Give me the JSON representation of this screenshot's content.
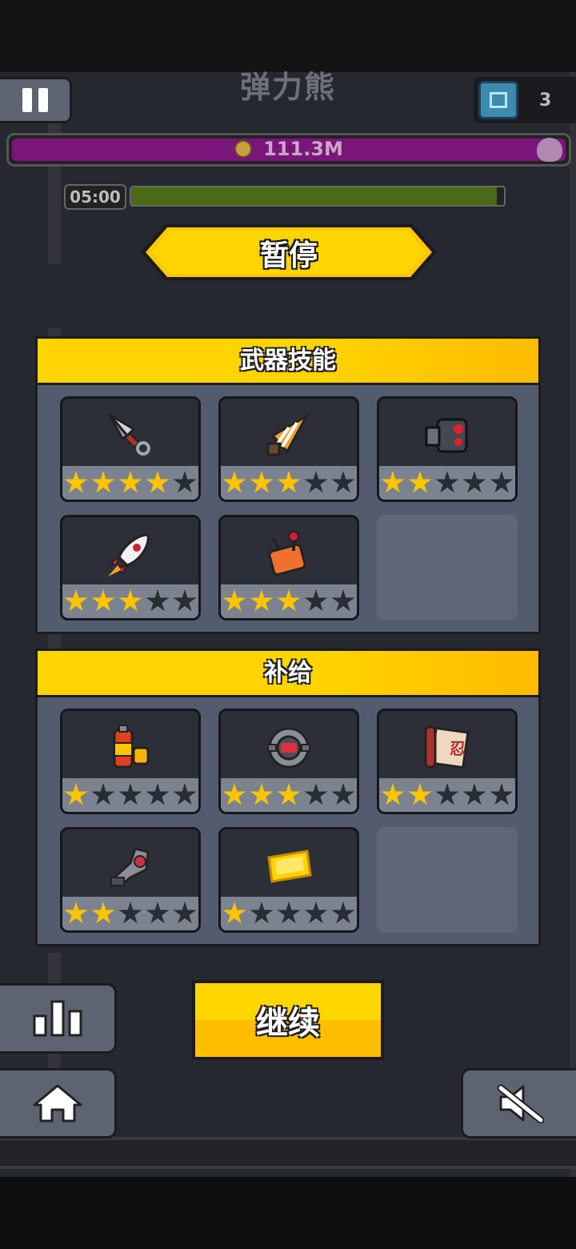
{
  "hud": {
    "stage_title": "弹力熊",
    "level_number": "3",
    "boss_value": "111.3M",
    "timer": "05:00",
    "timer_progress": 0.98
  },
  "pause_title": "暂停",
  "weapons": {
    "title": "武器技能",
    "slots": [
      {
        "icon": "kunai-icon",
        "stars": 4
      },
      {
        "icon": "drill-icon",
        "stars": 3
      },
      {
        "icon": "robot-fist-icon",
        "stars": 2
      },
      {
        "icon": "rocket-icon",
        "stars": 3
      },
      {
        "icon": "remote-control-icon",
        "stars": 3
      }
    ]
  },
  "supplies": {
    "title": "补给",
    "slots": [
      {
        "icon": "battery-icon",
        "stars": 1
      },
      {
        "icon": "core-orb-icon",
        "stars": 3
      },
      {
        "icon": "scroll-icon",
        "stars": 2
      },
      {
        "icon": "mech-arm-icon",
        "stars": 2
      },
      {
        "icon": "gold-ticket-icon",
        "stars": 1
      }
    ]
  },
  "continue_label": "继续",
  "colors": {
    "accent": "#ffd400",
    "panel": "#535b6e",
    "slot": "#2d2f38",
    "star_on": "#ffc400"
  }
}
